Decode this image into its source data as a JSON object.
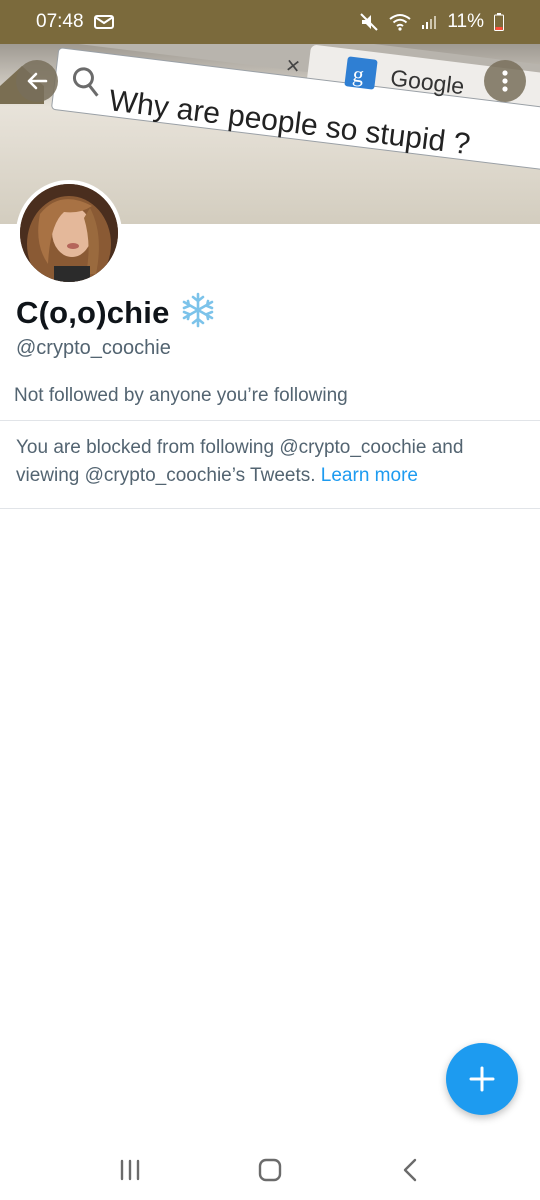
{
  "status_bar": {
    "time": "07:48",
    "battery": "11%",
    "icons": [
      "message-icon",
      "mute-icon",
      "wifi-icon",
      "signal-icon",
      "battery-icon"
    ]
  },
  "banner": {
    "search_text": "Why are people so stupid ?",
    "tab_label": "Google",
    "tab_close": "×",
    "google_badge": "g"
  },
  "profile": {
    "display_name": "C(o,o)chie",
    "name_emoji": "❄️",
    "handle": "@crypto_coochie",
    "followed_note": "Not followed by anyone you’re following"
  },
  "blocked_notice": {
    "text": "You are blocked from following @crypto_coochie and viewing @crypto_coochie’s Tweets.",
    "link": "Learn more"
  },
  "colors": {
    "accent": "#1d9bf0",
    "status_bar": "#7b6a3c",
    "secondary_text": "#536471"
  }
}
